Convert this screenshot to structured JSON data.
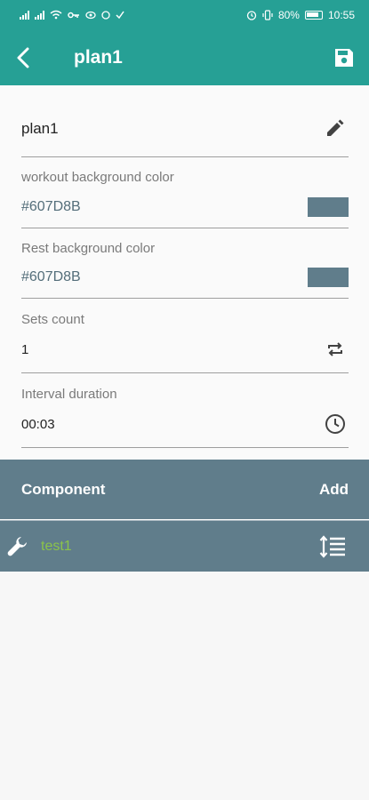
{
  "status_bar": {
    "battery": "80%",
    "time": "10:55"
  },
  "appbar": {
    "title": "plan1",
    "back_icon": "arrow-back-icon",
    "save_icon": "save-icon"
  },
  "form": {
    "name": {
      "value": "plan1",
      "icon": "edit-pencil-icon"
    },
    "workout_color": {
      "label": "workout background color",
      "value": "#607D8B",
      "swatch": "#607D8B"
    },
    "rest_color": {
      "label": "Rest background color",
      "value": "#607D8B",
      "swatch": "#607D8B"
    },
    "sets_count": {
      "label": "Sets count",
      "value": "1",
      "icon": "repeat-icon"
    },
    "interval_duration": {
      "label": "Interval duration",
      "value": "00:03",
      "icon": "clock-icon"
    }
  },
  "components": {
    "header": "Component",
    "add_label": "Add",
    "items": [
      {
        "name": "test1",
        "icon": "wrench-icon",
        "action_icon": "reorder-icon"
      }
    ]
  },
  "colors": {
    "primary": "#26A095",
    "component_bg": "#607D8B",
    "component_name": "#8BC34A"
  }
}
